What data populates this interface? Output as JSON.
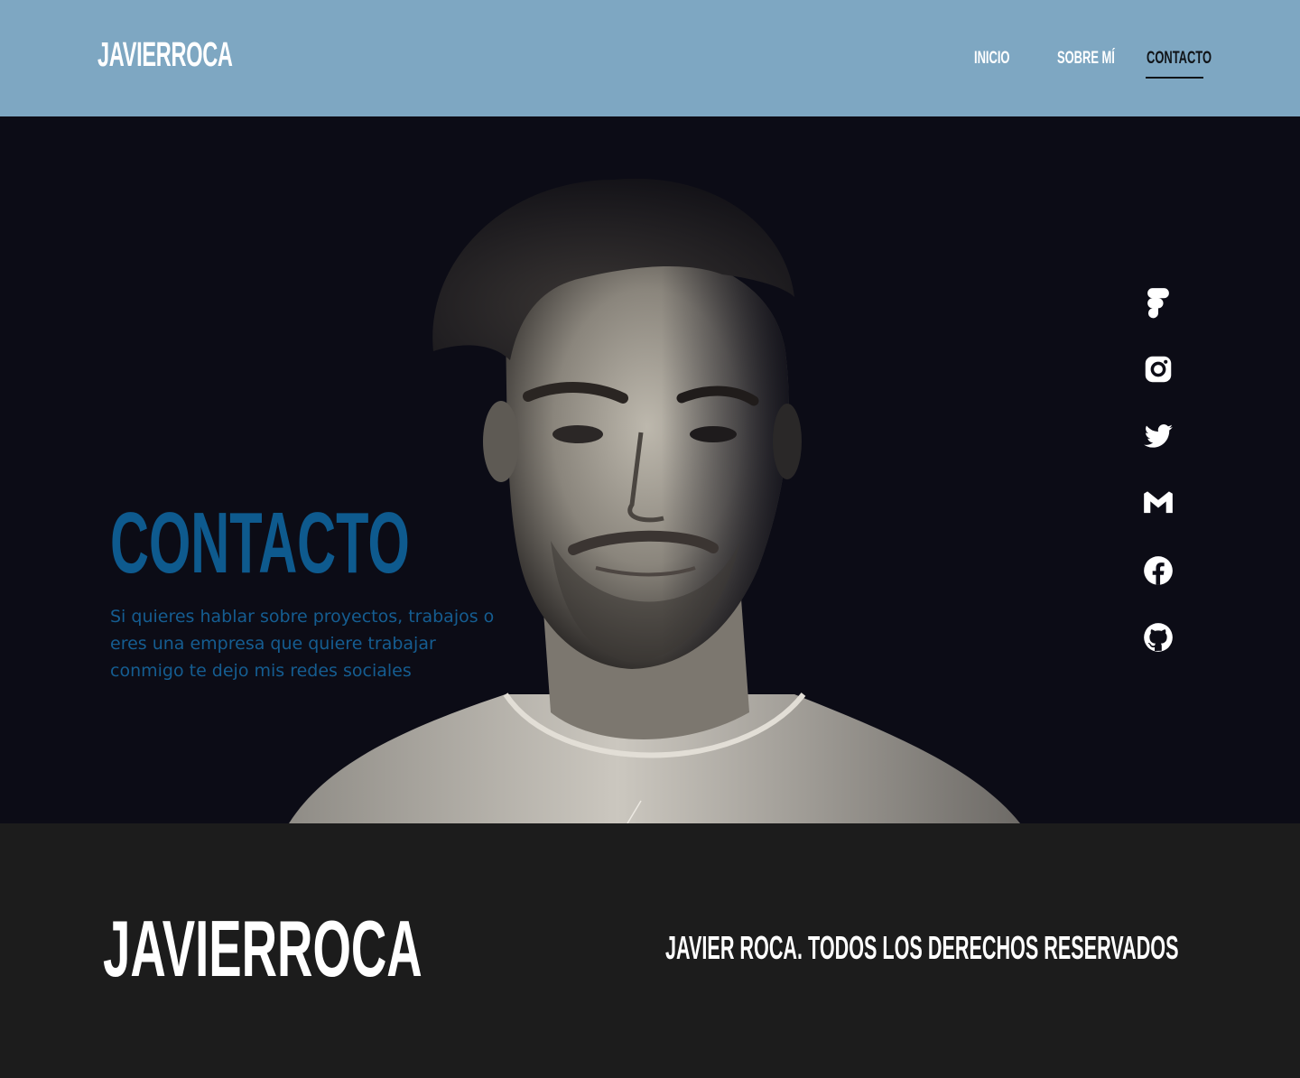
{
  "header": {
    "logo": "JAVIERROCA",
    "nav": [
      {
        "label": "INICIO",
        "active": false
      },
      {
        "label": "SOBRE MÍ",
        "active": false
      },
      {
        "label": "CONTACTO",
        "active": true
      }
    ]
  },
  "hero": {
    "title": "CONTACTO",
    "text": "Si quieres hablar sobre proyectos, trabajos o eres una empresa que quiere trabajar conmigo te dejo mis redes sociales",
    "image": "portrait-photo",
    "socials": [
      {
        "icon": "figma-icon"
      },
      {
        "icon": "instagram-icon"
      },
      {
        "icon": "twitter-icon"
      },
      {
        "icon": "gmail-icon"
      },
      {
        "icon": "facebook-icon"
      },
      {
        "icon": "github-icon"
      }
    ]
  },
  "footer": {
    "logo": "JAVIERROCA",
    "copyright": "JAVIER ROCA. TODOS LOS DERECHOS RESERVADOS"
  },
  "colors": {
    "header_bg": "#7ea7c2",
    "hero_bg": "#0c0c16",
    "accent_blue": "#0e5a8e",
    "footer_bg": "#1c1c1c",
    "white": "#ffffff"
  }
}
